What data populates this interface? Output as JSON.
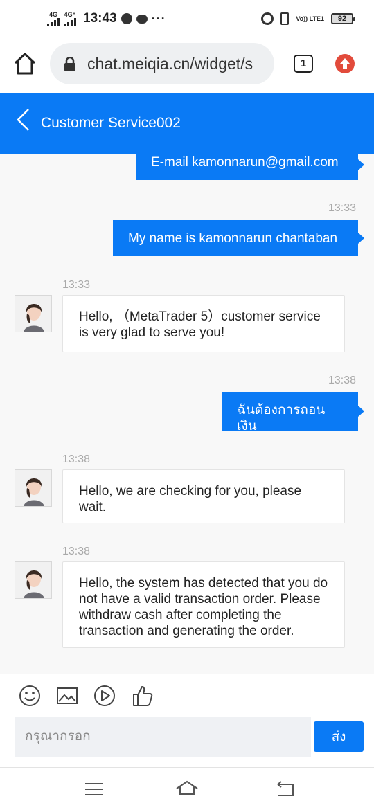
{
  "status_bar": {
    "sim1": "4G",
    "sim2": "4G⁺",
    "time": "13:43",
    "volte": "Vo)) LTE1",
    "battery": "92"
  },
  "browser": {
    "url": "chat.meiqia.cn/widget/s",
    "tab_count": "1"
  },
  "chat": {
    "title": "Customer Service002",
    "messages": [
      {
        "side": "out",
        "text": "E-mail kamonnarun@gmail.com"
      },
      {
        "side": "out",
        "time": "13:33",
        "text": "My name is kamonnarun chantaban"
      },
      {
        "side": "in",
        "time": "13:33",
        "text": "Hello, （MetaTrader 5）customer service is very glad to serve you!"
      },
      {
        "side": "out",
        "time": "13:38",
        "text": "ฉันต้องการถอนเงิน"
      },
      {
        "side": "in",
        "time": "13:38",
        "text": "Hello, we are checking for you, please wait."
      },
      {
        "side": "in",
        "time": "13:38",
        "text": "Hello, the system has detected that you do not have a valid transaction order. Please withdraw cash after completing the transaction and generating the order."
      }
    ]
  },
  "composer": {
    "placeholder": "กรุณากรอก",
    "send_label": "ส่ง",
    "tools": [
      "emoji-icon",
      "image-icon",
      "video-icon",
      "thumbs-up-icon"
    ]
  },
  "colors": {
    "accent": "#0a7af5",
    "update": "#e24b3b"
  }
}
